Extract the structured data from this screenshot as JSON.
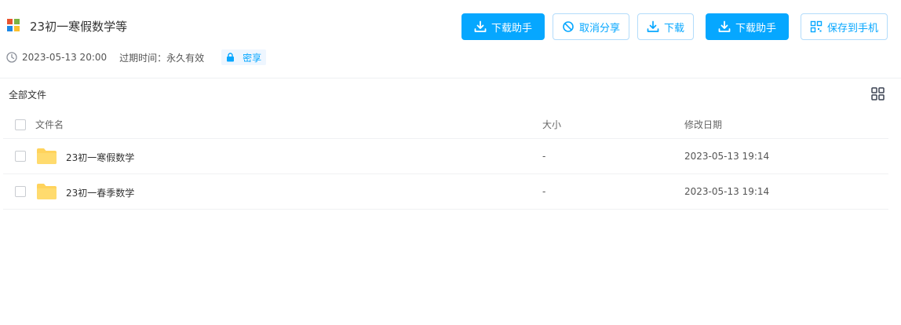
{
  "header": {
    "title": "23初一寒假数学等",
    "logo_colors": [
      "#e8542f",
      "#7cb342",
      "#1e88e5",
      "#fbc02d"
    ],
    "created_at": "2023-05-13 20:00",
    "expiry": "过期时间：永久有效",
    "share_badge": "密享",
    "clock_icon": "clock-icon",
    "lock_icon": "lock-icon"
  },
  "toolbar": {
    "download_helper_1": "下载助手",
    "cancel_share": "取消分享",
    "download": "下载",
    "download_helper_2": "下载助手",
    "save_to_phone": "保存到手机"
  },
  "colors": {
    "accent": "#06a7ff",
    "folder": "#ffd35c"
  },
  "file_list": {
    "section_label": "全部文件",
    "columns": {
      "name": "文件名",
      "size": "大小",
      "modified": "修改日期"
    },
    "rows": [
      {
        "name": "23初一寒假数学",
        "size": "-",
        "modified": "2023-05-13 19:14",
        "icon": "folder-icon"
      },
      {
        "name": "23初一春季数学",
        "size": "-",
        "modified": "2023-05-13 19:14",
        "icon": "folder-icon"
      }
    ]
  }
}
